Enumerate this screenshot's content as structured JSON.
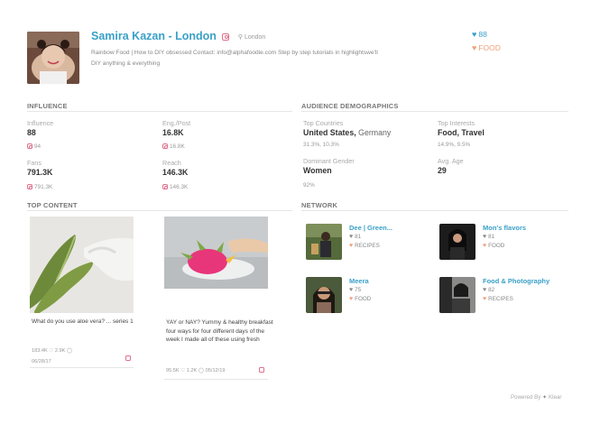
{
  "profile": {
    "name": "Samira Kazan - London",
    "location": "London",
    "bio": "Rainbow Food | How to DIY obsessed Contact: info@alphafoodie.com Step by step tutorials in highlightswe'll DIY anything & everything",
    "followers_count": "88",
    "category": "FOOD"
  },
  "influence": {
    "title": "INFLUENCE",
    "influence_label": "Influence",
    "influence_value": "88",
    "influence_sub": "94",
    "eng_label": "Eng./Post",
    "eng_value": "16.8K",
    "eng_sub": "16.8K",
    "fans_label": "Fans",
    "fans_value": "791.3K",
    "fans_sub": "791.3K",
    "reach_label": "Reach",
    "reach_value": "146.3K",
    "reach_sub": "146.3K"
  },
  "audience": {
    "title": "AUDIENCE DEMOGRAPHICS",
    "countries_label": "Top Countries",
    "country1": "United States,",
    "country2": "Germany",
    "countries_sub": "31.3%, 10.3%",
    "interests_label": "Top Interests",
    "interests_value": "Food, Travel",
    "interests_sub": "14.9%, 9.5%",
    "gender_label": "Dominant Gender",
    "gender_value": "Women",
    "gender_sub": "92%",
    "age_label": "Avg. Age",
    "age_value": "29"
  },
  "top_content": {
    "title": "TOP CONTENT",
    "posts": [
      {
        "caption": "What do you use aloe vera? ... series 1",
        "likes": "183.4K",
        "comments": "2.9K",
        "date": "06/28/17"
      },
      {
        "caption": "YAY or NAY? Yummy & healthy breakfast four ways for four different days of the week    I made all of these using fresh",
        "likes": "95.5K",
        "comments": "1.2K",
        "date": "05/12/19"
      }
    ]
  },
  "network": {
    "title": "NETWORK",
    "items": [
      {
        "name": "Dee | Green...",
        "score": "81",
        "category": "RECIPES"
      },
      {
        "name": "Mon's flavors",
        "score": "81",
        "category": "FOOD"
      },
      {
        "name": "Meera",
        "score": "75",
        "category": "FOOD"
      },
      {
        "name": "Food & Photography",
        "score": "82",
        "category": "RECIPES"
      }
    ]
  },
  "footer": {
    "powered_by": "Powered By",
    "brand": "Klear"
  },
  "colors": {
    "accent_blue": "#3aa0c8",
    "accent_orange": "#f0a07a",
    "instagram_pink": "#e0708a"
  }
}
